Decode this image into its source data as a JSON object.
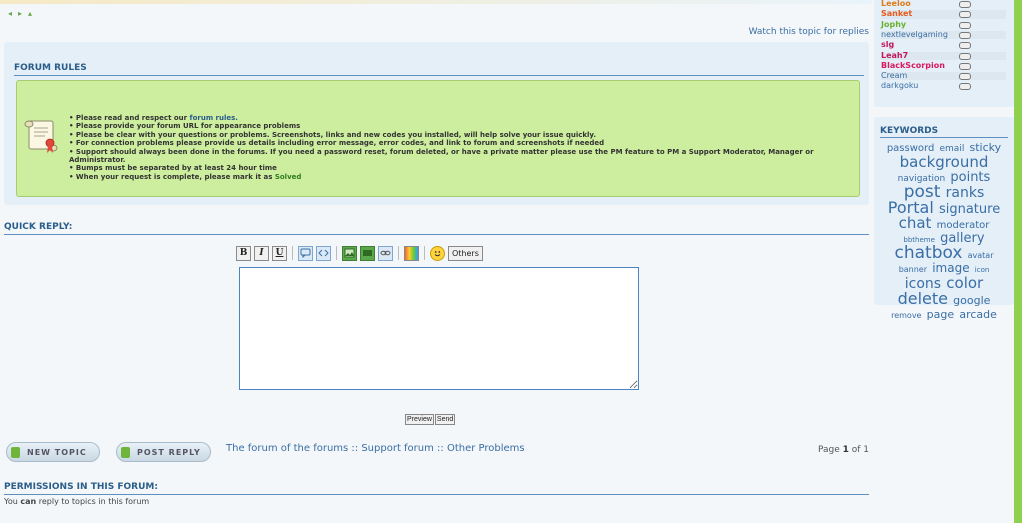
{
  "topic_nav": {
    "prev_glyph": "◂",
    "next_glyph": "▸",
    "up_glyph": "▴"
  },
  "watch_link": "Watch this topic for replies",
  "forum_rules": {
    "title": "FORUM RULES",
    "icon": "scroll-certificate-icon",
    "items": [
      {
        "pre": "• Please read and respect our ",
        "link": "forum rules.",
        "post": ""
      },
      {
        "pre": "• Please provide your forum URL for appearance problems",
        "link": "",
        "post": ""
      },
      {
        "pre": "• Please be clear with your questions or problems. Screenshots, links and new codes you installed, will help solve your issue quickly.",
        "link": "",
        "post": ""
      },
      {
        "pre": "• For connection problems please provide us details including error message, error codes, and link to forum and screenshots if needed",
        "link": "",
        "post": ""
      },
      {
        "pre": "• Support should always been done in the forums. If you need a password reset, forum deleted, or have a private matter please use the PM feature to PM a Support Moderator, Manager or Administrator.",
        "link": "",
        "post": ""
      },
      {
        "pre": "• Bumps must be separated by at least 24 hour time",
        "link": "",
        "post": ""
      },
      {
        "pre": "• When your request is complete, please mark it as ",
        "link": "",
        "post": "Solved"
      }
    ]
  },
  "quick_reply": {
    "title": "QUICK REPLY:",
    "toolbar": {
      "bold": "B",
      "italic": "I",
      "underline": "U",
      "others": "Others",
      "icons": [
        "quote-icon",
        "code-icon",
        "image-icon",
        "video-icon",
        "link-icon",
        "color-icon",
        "smiley-icon"
      ]
    },
    "message": "",
    "preview": "Preview",
    "send": "Send"
  },
  "actions": {
    "new_topic": "NEW TOPIC",
    "post_reply": "POST REPLY"
  },
  "breadcrumb": "The forum of the forums :: Support forum :: Other Problems",
  "pagination": {
    "pre": "Page ",
    "current": "1",
    "mid": " of ",
    "total": "1"
  },
  "permissions": {
    "title": "PERMISSIONS IN THIS FORUM:",
    "pre": "You ",
    "bold": "can",
    "post": " reply to topics in this forum"
  },
  "online_users": [
    {
      "name": "Leeloo",
      "color": "#e07b19"
    },
    {
      "name": "Sanket",
      "color": "#e85a1a"
    },
    {
      "name": "Jophy",
      "color": "#69b12e"
    },
    {
      "name": "nextlevelgaming",
      "color": "#3a6ea5"
    },
    {
      "name": "slg",
      "color": "#c2185b"
    },
    {
      "name": "Leah7",
      "color": "#c2185b"
    },
    {
      "name": "BlackScorpion",
      "color": "#d81b60"
    },
    {
      "name": "Cream",
      "color": "#3a6ea5"
    },
    {
      "name": "darkgoku",
      "color": "#3a6ea5"
    }
  ],
  "keywords": {
    "title": "KEYWORDS",
    "tags": [
      {
        "t": "password",
        "s": 10
      },
      {
        "t": "email",
        "s": 9
      },
      {
        "t": "sticky",
        "s": 11
      },
      {
        "t": "background",
        "s": 15
      },
      {
        "t": "navigation",
        "s": 9
      },
      {
        "t": "points",
        "s": 13
      },
      {
        "t": "post",
        "s": 17
      },
      {
        "t": "ranks",
        "s": 14
      },
      {
        "t": "Portal",
        "s": 16
      },
      {
        "t": "signature",
        "s": 13
      },
      {
        "t": "chat",
        "s": 15
      },
      {
        "t": "moderator",
        "s": 10
      },
      {
        "t": "bbtheme",
        "s": 7
      },
      {
        "t": "gallery",
        "s": 13
      },
      {
        "t": "chatbox",
        "s": 17
      },
      {
        "t": "avatar",
        "s": 8
      },
      {
        "t": "banner",
        "s": 8
      },
      {
        "t": "image",
        "s": 12
      },
      {
        "t": "icon",
        "s": 7
      },
      {
        "t": "icons",
        "s": 14
      },
      {
        "t": "color",
        "s": 15
      },
      {
        "t": "delete",
        "s": 16
      },
      {
        "t": "google",
        "s": 11
      },
      {
        "t": "remove",
        "s": 8
      },
      {
        "t": "page",
        "s": 11
      },
      {
        "t": "arcade",
        "s": 11
      }
    ]
  }
}
